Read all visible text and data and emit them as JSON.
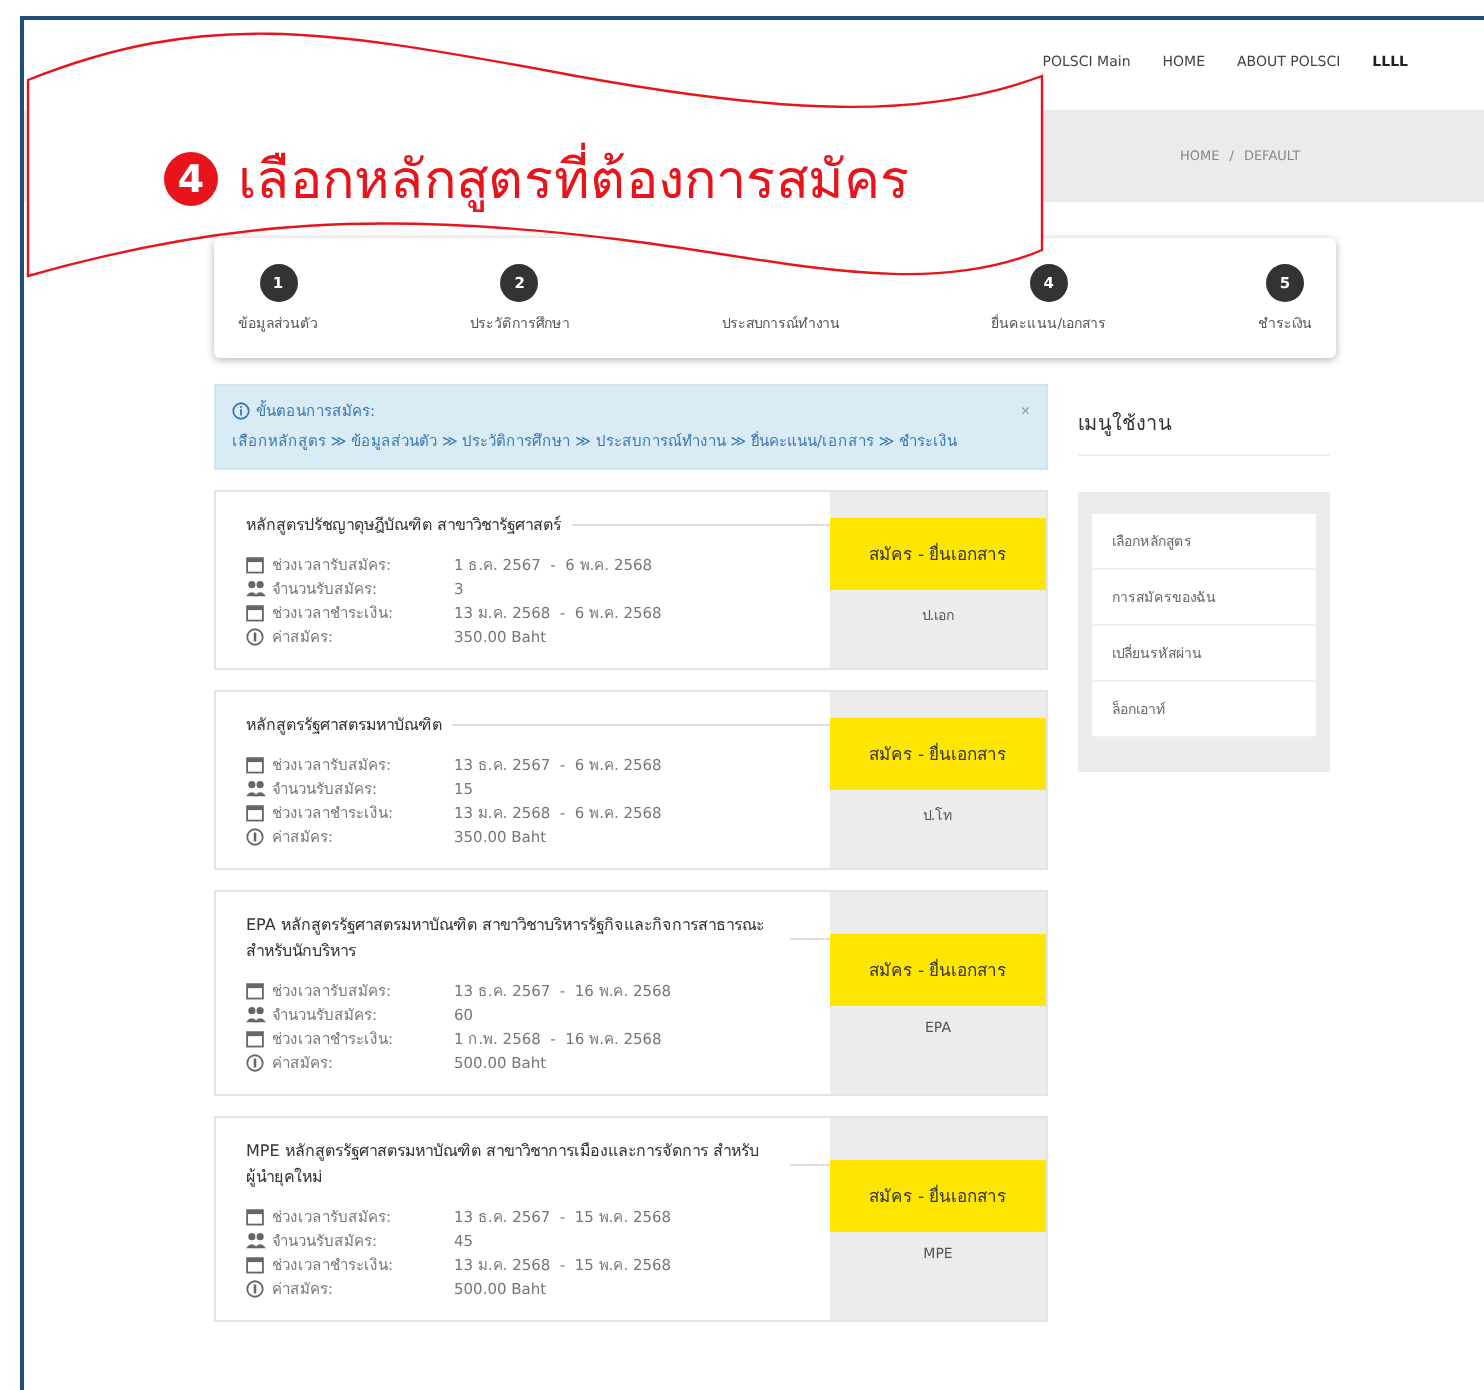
{
  "callout": {
    "number": "4",
    "text": "เลือกหลักสูตรที่ต้องการสมัคร"
  },
  "nav": [
    {
      "label": "POLSCI Main",
      "selected": false
    },
    {
      "label": "HOME",
      "selected": false
    },
    {
      "label": "ABOUT POLSCI",
      "selected": false
    },
    {
      "label": "LLLL",
      "selected": true
    }
  ],
  "breadcrumb": [
    "HOME",
    "/",
    "DEFAULT"
  ],
  "steps": [
    {
      "number": "1",
      "label": "ข้อมูลส่วนตัว"
    },
    {
      "number": "2",
      "label": "ประวัติการศึกษา"
    },
    {
      "label": "ประสบการณ์ทำงาน"
    },
    {
      "number": "4",
      "label": "ยื่นคะแนน/เอกสาร"
    },
    {
      "number": "5",
      "label": "ชำระเงิน"
    }
  ],
  "alert": {
    "title": "ขั้นตอนการสมัคร:",
    "steps": "เลือกหลักสูตร ≫ ข้อมูลส่วนตัว ≫ ประวัติการศึกษา ≫ ประสบการณ์ทำงาน ≫ ยื่นคะแนน/เอกสาร ≫ ชำระเงิน",
    "close": "×"
  },
  "programs": [
    {
      "title": "หลักสูตรปรัชญาดุษฎีบัณฑิต สาขาวิชารัฐศาสตร์",
      "rows": [
        {
          "kind": "date",
          "label": "ช่วงเวลารับสมัคร:",
          "value": "1 ธ.ค. 2567  -  6 พ.ค. 2568"
        },
        {
          "kind": "seats",
          "label": "จำนวนรับสมัคร:",
          "value": "3"
        },
        {
          "kind": "date",
          "label": "ช่วงเวลาชำระเงิน:",
          "value": "13 ม.ค. 2568  -  6 พ.ค. 2568"
        },
        {
          "kind": "fee",
          "label": "ค่าสมัคร:",
          "value": "350.00 Baht"
        }
      ],
      "button": "สมัคร - ยื่นเอกสาร",
      "code": "ป.เอก"
    },
    {
      "title": "หลักสูตรรัฐศาสตรมหาบัณฑิต",
      "rows": [
        {
          "kind": "date",
          "label": "ช่วงเวลารับสมัคร:",
          "value": "13 ธ.ค. 2567  -  6 พ.ค. 2568"
        },
        {
          "kind": "seats",
          "label": "จำนวนรับสมัคร:",
          "value": "15"
        },
        {
          "kind": "date",
          "label": "ช่วงเวลาชำระเงิน:",
          "value": "13 ม.ค. 2568  -  6 พ.ค. 2568"
        },
        {
          "kind": "fee",
          "label": "ค่าสมัคร:",
          "value": "350.00 Baht"
        }
      ],
      "button": "สมัคร - ยื่นเอกสาร",
      "code": "ป.โท"
    },
    {
      "title": "EPA หลักสูตรรัฐศาสตรมหาบัณฑิต สาขาวิชาบริหารรัฐกิจและกิจการสาธารณะ สำหรับนักบริหาร",
      "rows": [
        {
          "kind": "date",
          "label": "ช่วงเวลารับสมัคร:",
          "value": "13 ธ.ค. 2567  -  16 พ.ค. 2568"
        },
        {
          "kind": "seats",
          "label": "จำนวนรับสมัคร:",
          "value": "60"
        },
        {
          "kind": "date",
          "label": "ช่วงเวลาชำระเงิน:",
          "value": "1 ก.พ. 2568  -  16 พ.ค. 2568"
        },
        {
          "kind": "fee",
          "label": "ค่าสมัคร:",
          "value": "500.00 Baht"
        }
      ],
      "button": "สมัคร - ยื่นเอกสาร",
      "code": "EPA"
    },
    {
      "title": "MPE หลักสูตรรัฐศาสตรมหาบัณฑิต สาขาวิชาการเมืองและการจัดการ สำหรับผู้นำยุคใหม่",
      "rows": [
        {
          "kind": "date",
          "label": "ช่วงเวลารับสมัคร:",
          "value": "13 ธ.ค. 2567  -  15 พ.ค. 2568"
        },
        {
          "kind": "seats",
          "label": "จำนวนรับสมัคร:",
          "value": "45"
        },
        {
          "kind": "date",
          "label": "ช่วงเวลาชำระเงิน:",
          "value": "13 ม.ค. 2568  -  15 พ.ค. 2568"
        },
        {
          "kind": "fee",
          "label": "ค่าสมัคร:",
          "value": "500.00 Baht"
        }
      ],
      "button": "สมัคร - ยื่นเอกสาร",
      "code": "MPE"
    }
  ],
  "sidebar": {
    "title": "เมนูใช้งาน",
    "items": [
      "เลือกหลักสูตร",
      "การสมัครของฉัน",
      "เปลี่ยนรหัสผ่าน",
      "ล็อกเอาท์"
    ]
  }
}
